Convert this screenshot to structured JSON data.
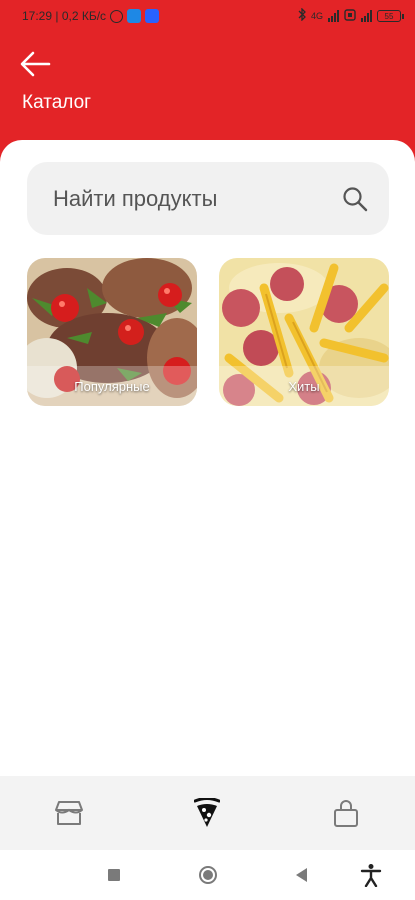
{
  "status_bar": {
    "time_speed": "17:29 | 0,2 КБ/с",
    "network_label": "4G",
    "battery_level": "55"
  },
  "header": {
    "title": "Каталог",
    "back_icon": "arrow-left-icon"
  },
  "search": {
    "placeholder": "Найти продукты",
    "icon": "search-icon"
  },
  "categories": [
    {
      "label": "Популярные",
      "image": "pizza-with-tomatoes-and-meat"
    },
    {
      "label": "Хиты",
      "image": "pizza-with-sausages-and-fries"
    }
  ],
  "bottom_nav": {
    "items": [
      {
        "icon": "store-icon",
        "active": false
      },
      {
        "icon": "pizza-slice-icon",
        "active": true
      },
      {
        "icon": "shopping-bag-icon",
        "active": false
      }
    ]
  },
  "system_nav": {
    "buttons": [
      "recent-apps-icon",
      "home-icon",
      "back-triangle-icon",
      "accessibility-icon"
    ]
  },
  "colors": {
    "accent": "#e32427",
    "search_bg": "#f1f1f1",
    "nav_bg": "#f3f3f3",
    "nav_icon": "#7a7a7a",
    "nav_icon_active": "#111111"
  }
}
